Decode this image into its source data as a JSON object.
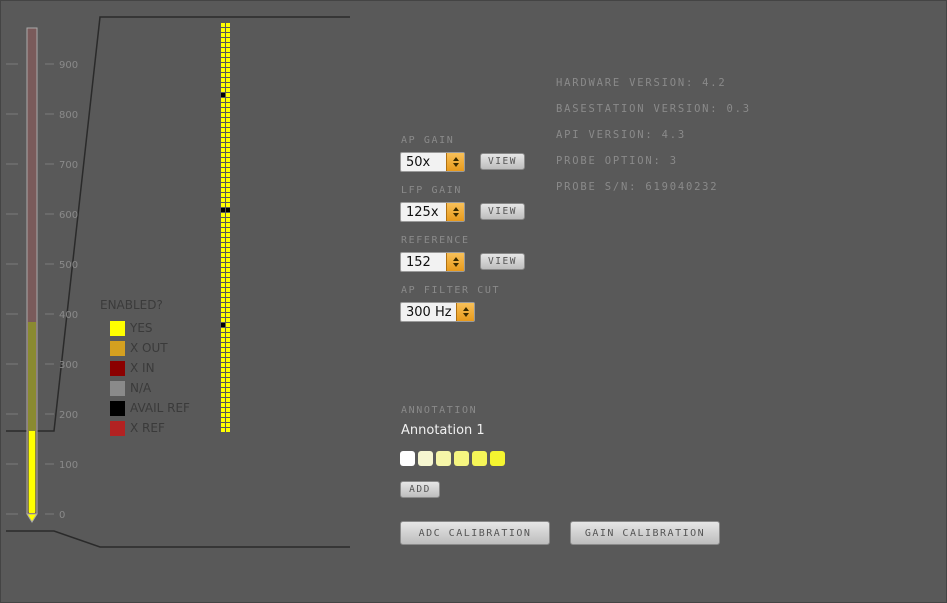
{
  "colors": {
    "yes": "#ffff00",
    "x_out": "#d4a020",
    "x_in": "#8b0000",
    "na": "#8a8a8a",
    "avail_ref": "#000000",
    "x_ref": "#b22222"
  },
  "probe": {
    "depth_ticks": [
      "900",
      "800",
      "700",
      "600",
      "500",
      "400",
      "300",
      "200",
      "100",
      "0"
    ],
    "reference_channels_shown": "black marks"
  },
  "legend": {
    "title": "ENABLED?",
    "items": [
      {
        "label": "YES",
        "color": "#ffff00"
      },
      {
        "label": "X OUT",
        "color": "#d4a020"
      },
      {
        "label": "X IN",
        "color": "#8b0000"
      },
      {
        "label": "N/A",
        "color": "#8a8a8a"
      },
      {
        "label": "AVAIL REF",
        "color": "#000000"
      },
      {
        "label": "X REF",
        "color": "#b22222"
      }
    ]
  },
  "controls": {
    "ap_gain": {
      "label": "AP GAIN",
      "value": "50x",
      "view": "VIEW"
    },
    "lfp_gain": {
      "label": "LFP GAIN",
      "value": "125x",
      "view": "VIEW"
    },
    "reference": {
      "label": "REFERENCE",
      "value": "152",
      "view": "VIEW"
    },
    "ap_filter": {
      "label": "AP FILTER CUT",
      "value": "300 Hz"
    }
  },
  "info": {
    "hardware_version": "HARDWARE VERSION: 4.2",
    "basestation_version": "BASESTATION VERSION: 0.3",
    "api_version": "API VERSION: 4.3",
    "probe_option": "PROBE OPTION: 3",
    "probe_sn": "PROBE S/N: 619040232"
  },
  "annotation": {
    "label": "ANNOTATION",
    "text": "Annotation 1",
    "swatches": [
      "#ffffff",
      "#f5f5d0",
      "#f5f5a8",
      "#f5f580",
      "#f5f558",
      "#f5f530"
    ],
    "add": "ADD"
  },
  "buttons": {
    "adc_calibration": "ADC CALIBRATION",
    "gain_calibration": "GAIN CALIBRATION"
  }
}
